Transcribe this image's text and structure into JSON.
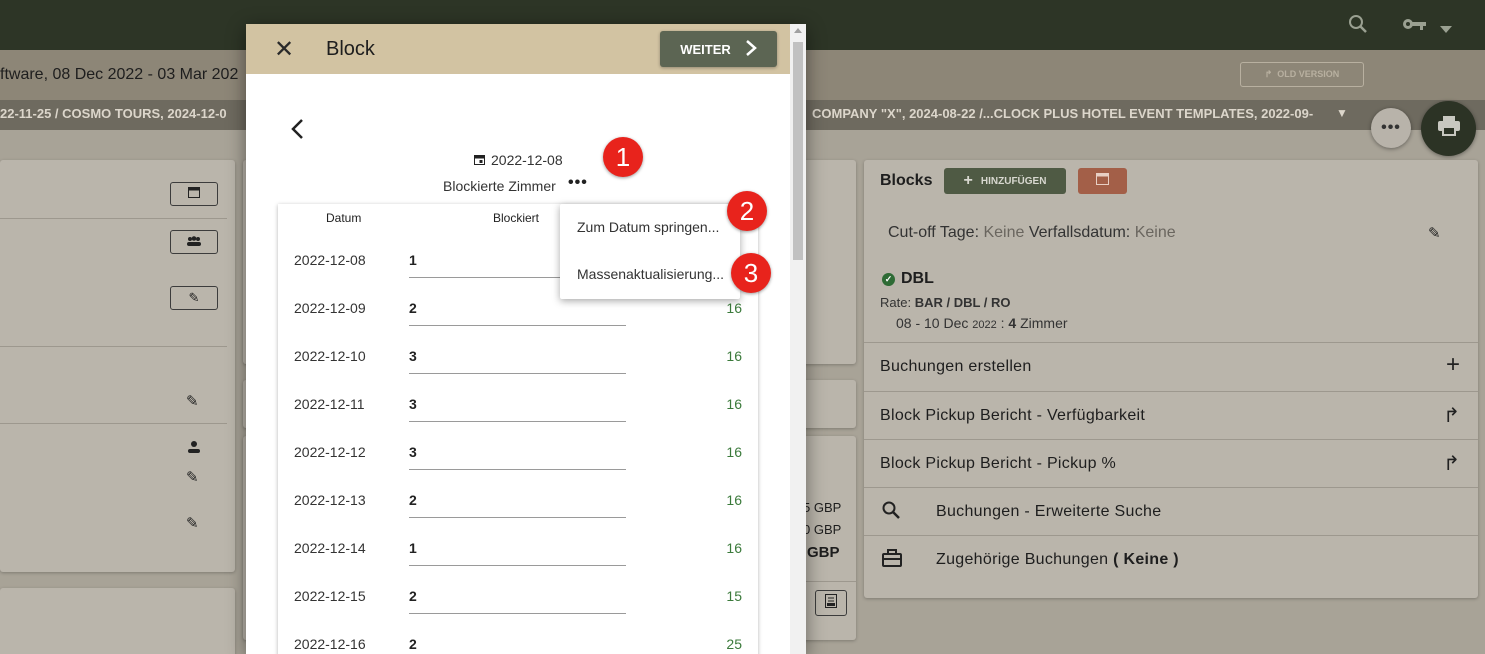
{
  "app": {
    "subtitle": "ftware, 08 Dec 2022 - 03 Mar 202",
    "old_version": "OLD VERSION",
    "crumbs_left": "22-11-25  /  COSMO TOURS, 2024-12-0",
    "crumbs_right": "COMPANY \"X\", 2024-08-22  /...CLOCK PLUS HOTEL EVENT TEMPLATES, 2022-09-",
    "more_label": "•••"
  },
  "blocks_panel": {
    "title": "Blocks",
    "add_label": "HINZUFÜGEN",
    "cutoff_label": "Cut-off Tage:",
    "cutoff_value": "Keine",
    "expiry_label": "Verfallsdatum:",
    "expiry_value": "Keine",
    "room_type": "DBL",
    "rate_label": "Rate:",
    "rate_value": "BAR / DBL / RO",
    "date_range": "08 - 10 Dec",
    "year": "2022",
    "rooms_sep": " : ",
    "rooms_count": "4",
    "rooms_word": "Zimmer",
    "actions": [
      {
        "label": "Buchungen erstellen",
        "icon": "plus-icon"
      },
      {
        "label": "Block Pickup Bericht - Verfügbarkeit",
        "icon": "share-arrow-icon"
      },
      {
        "label": "Block Pickup Bericht - Pickup %",
        "icon": "share-arrow-icon"
      },
      {
        "label": "Buchungen - Erweiterte Suche",
        "icon": "search-icon"
      },
      {
        "label": "Zugehörige Buchungen",
        "paren_open": "( ",
        "extra": "Keine",
        "paren_close": " )",
        "icon": "briefcase-icon"
      }
    ]
  },
  "middle": {
    "gbp1": "5 GBP",
    "gbp2": "0 GBP",
    "gbp3": "GBP"
  },
  "modal": {
    "title": "Block",
    "next_label": "WEITER",
    "date": "2022-12-08",
    "blocked_rooms_label": "Blockierte Zimmer",
    "dots": "•••",
    "col_date": "Datum",
    "col_blocked": "Blockiert",
    "rows": [
      {
        "date": "2022-12-08",
        "blocked": "1",
        "avail": ""
      },
      {
        "date": "2022-12-09",
        "blocked": "2",
        "avail": "16"
      },
      {
        "date": "2022-12-10",
        "blocked": "3",
        "avail": "16"
      },
      {
        "date": "2022-12-11",
        "blocked": "3",
        "avail": "16"
      },
      {
        "date": "2022-12-12",
        "blocked": "3",
        "avail": "16"
      },
      {
        "date": "2022-12-13",
        "blocked": "2",
        "avail": "16"
      },
      {
        "date": "2022-12-14",
        "blocked": "1",
        "avail": "16"
      },
      {
        "date": "2022-12-15",
        "blocked": "2",
        "avail": "15"
      },
      {
        "date": "2022-12-16",
        "blocked": "2",
        "avail": "25"
      }
    ],
    "menu": {
      "jump_to_date": "Zum Datum springen...",
      "bulk_update": "Massenaktualisierung..."
    }
  },
  "badges": [
    "1",
    "2",
    "3"
  ]
}
